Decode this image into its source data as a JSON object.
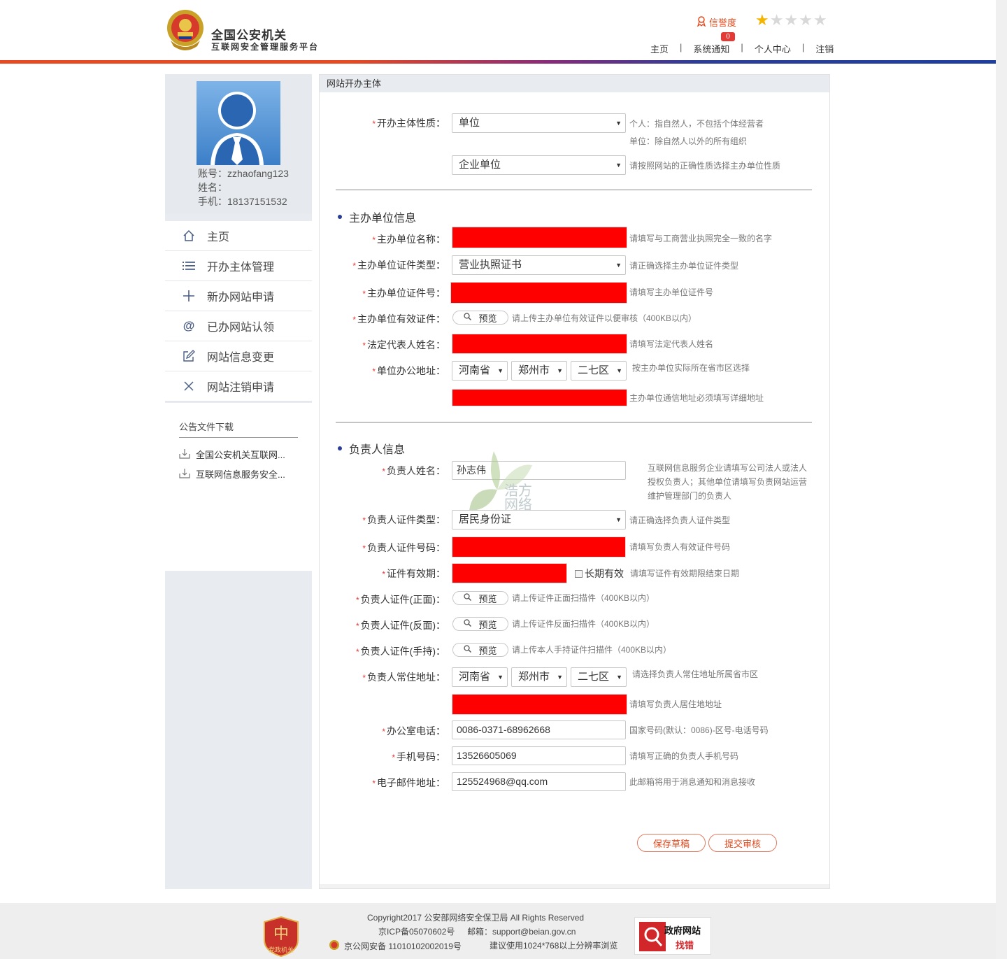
{
  "header": {
    "title": "全国公安机关",
    "subtitle": "互联网安全管理服务平台",
    "credit_label": "信誉度",
    "stars_total": 5,
    "stars_filled": 1,
    "notice_count": "0",
    "nav": [
      "主页",
      "系统通知",
      "个人中心",
      "注销"
    ],
    "colors": {
      "accent": "#e4491d",
      "brand_blue": "#2c3d99"
    }
  },
  "sidebar": {
    "account_label": "账号：zzhaofang123",
    "name_label": "姓名：",
    "phone_label": "手机：18137151532",
    "menu": [
      {
        "label": "主页",
        "icon": "home-icon"
      },
      {
        "label": "开办主体管理",
        "icon": "list-icon"
      },
      {
        "label": "新办网站申请",
        "icon": "plus-icon"
      },
      {
        "label": "已办网站认领",
        "icon": "at-icon"
      },
      {
        "label": "网站信息变更",
        "icon": "edit-icon"
      },
      {
        "label": "网站注销申请",
        "icon": "close-icon"
      }
    ],
    "downloads_title": "公告文件下载",
    "downloads": [
      "全国公安机关互联网...",
      "互联网信息服务安全..."
    ]
  },
  "main": {
    "panel_title": "网站开办主体",
    "required_mark": "*",
    "subject_nature": {
      "label": "开办主体性质：",
      "value": "单位",
      "hint1": "个人：指自然人，不包括个体经营者",
      "hint2": "单位：除自然人以外的所有组织",
      "sub_value": "企业单位",
      "sub_hint": "请按照网站的正确性质选择主办单位性质"
    },
    "unit_section": {
      "title": "主办单位信息",
      "name_label": "主办单位名称：",
      "name_hint": "请填写与工商营业执照完全一致的名字",
      "cert_type_label": "主办单位证件类型：",
      "cert_type_value": "营业执照证书",
      "cert_type_hint": "请正确选择主办单位证件类型",
      "cert_no_label": "主办单位证件号：",
      "cert_no_hint": "请填写主办单位证件号",
      "valid_cert_label": "主办单位有效证件：",
      "preview_label": "预览",
      "valid_cert_hint": "请上传主办单位有效证件以便审核（400KB以内）",
      "legal_label": "法定代表人姓名：",
      "legal_hint": "请填写法定代表人姓名",
      "addr_label": "单位办公地址：",
      "province": "河南省",
      "city": "郑州市",
      "district": "二七区",
      "addr_hint": "按主办单位实际所在省市区选择",
      "addr_detail_hint": "主办单位通信地址必须填写详细地址"
    },
    "person_section": {
      "title": "负责人信息",
      "name_label": "负责人姓名：",
      "name_value": "孙志伟",
      "name_hint_lines": [
        "互联网信息服务企业请填写公司法人或法人",
        "授权负责人；其他单位请填写负责网站运营",
        "维护管理部门的负责人"
      ],
      "cert_type_label": "负责人证件类型：",
      "cert_type_value": "居民身份证",
      "cert_type_hint": "请正确选择负责人证件类型",
      "cert_no_label": "负责人证件号码：",
      "cert_no_hint": "请填写负责人有效证件号码",
      "validity_label": "证件有效期：",
      "long_term_label": "长期有效",
      "validity_hint": "请填写证件有效期限结束日期",
      "front_label": "负责人证件(正面)：",
      "front_hint": "请上传证件正面扫描件（400KB以内）",
      "back_label": "负责人证件(反面)：",
      "back_hint": "请上传证件反面扫描件（400KB以内）",
      "hold_label": "负责人证件(手持)：",
      "hold_hint": "请上传本人手持证件扫描件（400KB以内）",
      "addr_label": "负责人常住地址：",
      "province": "河南省",
      "city": "郑州市",
      "district": "二七区",
      "addr_hint": "请选择负责人常住地址所属省市区",
      "addr_detail_hint": "请填写负责人居住地地址",
      "office_phone_label": "办公室电话：",
      "office_phone_value": "0086-0371-68962668",
      "office_phone_hint": "国家号码(默认：0086)-区号-电话号码",
      "mobile_label": "手机号码：",
      "mobile_value": "13526605069",
      "mobile_hint": "请填写正确的负责人手机号码",
      "email_label": "电子邮件地址：",
      "email_value": "125524968@qq.com",
      "email_hint": "此邮箱将用于消息通知和消息接收"
    },
    "buttons": {
      "save": "保存草稿",
      "submit": "提交审核"
    },
    "watermark": {
      "line1": "浩方",
      "line2": "网络"
    }
  },
  "footer": {
    "copyright": "Copyright2017 公安部网络安全保卫局 All Rights Reserved",
    "icp": "京ICP备05070602号",
    "email": "邮箱：support@beian.gov.cn",
    "police_record": "京公网安备 11010102002019号",
    "resolution": "建议使用1024*768以上分辨率浏览",
    "dangzheng_label": "党政机关",
    "zhaocuo_line1": "政府网站",
    "zhaocuo_line2": "找错"
  }
}
